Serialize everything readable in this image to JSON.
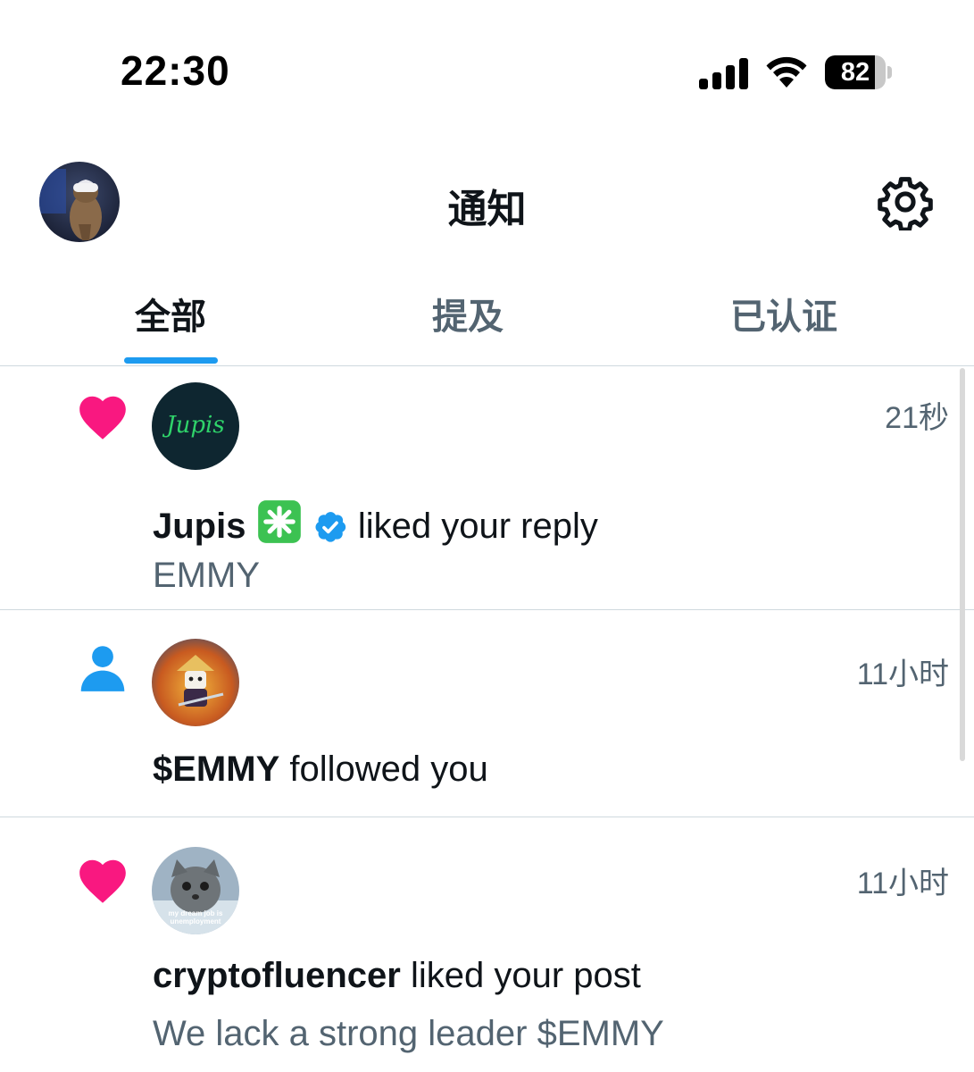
{
  "status_bar": {
    "time": "22:30",
    "battery": 82,
    "battery_label": "82",
    "icons": [
      "signal-icon",
      "wifi-icon",
      "battery-icon"
    ]
  },
  "header": {
    "title": "通知",
    "settings_icon": "gear-icon"
  },
  "tabs": [
    {
      "label": "全部",
      "active": true
    },
    {
      "label": "提及",
      "active": false
    },
    {
      "label": "已认证",
      "active": false
    }
  ],
  "notifications": [
    {
      "type_icon": "heart-icon",
      "user": "Jupis",
      "avatar_text": "Jupis",
      "action": "liked your reply",
      "subtext": "EMMY",
      "time": "21秒"
    },
    {
      "type_icon": "person-icon",
      "user": "$EMMY",
      "action": "followed you",
      "subtext": "",
      "time": "11小时"
    },
    {
      "type_icon": "heart-icon",
      "user": "cryptofluencer",
      "avatar_caption": "my dream job is unemployment",
      "action": "liked your post",
      "subtext": "We lack a strong leader $EMMY",
      "time": "11小时"
    }
  ],
  "colors": {
    "accent": "#1d9bf0",
    "heart": "#f91880",
    "text": "#0f1419",
    "secondary": "#536471",
    "divider": "#cfd9de"
  }
}
